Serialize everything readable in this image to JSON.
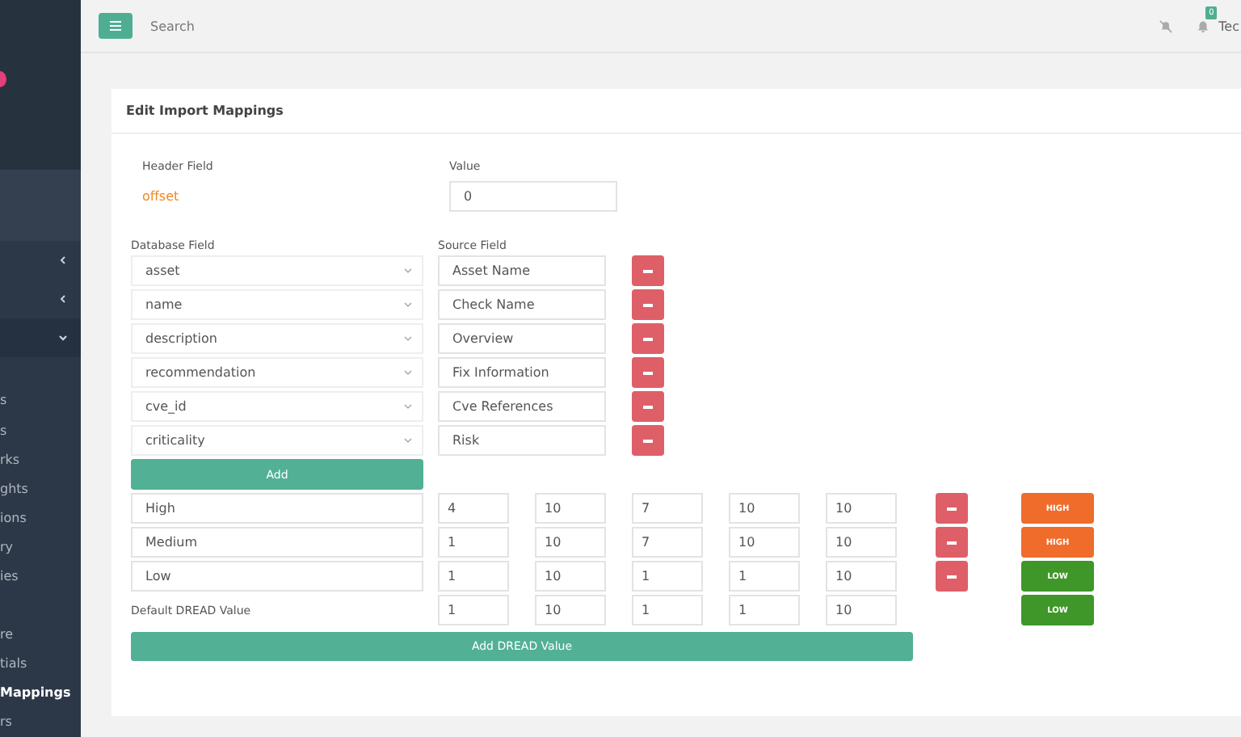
{
  "topbar": {
    "search_placeholder": "Search",
    "notification_count": "0",
    "user": "Tec"
  },
  "sidebar": {
    "items": [
      {
        "kind": "group",
        "expanded": false
      },
      {
        "kind": "group",
        "expanded": false
      },
      {
        "kind": "group",
        "expanded": true
      },
      {
        "kind": "link",
        "label": "s",
        "selected": false
      },
      {
        "kind": "link",
        "label": "s",
        "selected": false
      },
      {
        "kind": "link",
        "label": "rks",
        "selected": false
      },
      {
        "kind": "link",
        "label": "ghts",
        "selected": false
      },
      {
        "kind": "link",
        "label": "ions",
        "selected": false
      },
      {
        "kind": "link",
        "label": "ry",
        "selected": false
      },
      {
        "kind": "link",
        "label": "ies",
        "selected": false
      },
      {
        "kind": "link",
        "label": "re",
        "selected": false
      },
      {
        "kind": "link",
        "label": "tials",
        "selected": false
      },
      {
        "kind": "link",
        "label": "Mappings",
        "selected": true
      },
      {
        "kind": "link",
        "label": "rs",
        "selected": false
      }
    ]
  },
  "card": {
    "title": "Edit Import Mappings",
    "header": {
      "field_label": "Header Field",
      "value_label": "Value",
      "field": "offset",
      "value": "0"
    },
    "mappings": {
      "database_label": "Database Field",
      "source_label": "Source Field",
      "add_button": "Add",
      "rows": [
        {
          "database": "asset",
          "source": "Asset Name"
        },
        {
          "database": "name",
          "source": "Check Name"
        },
        {
          "database": "description",
          "source": "Overview"
        },
        {
          "database": "recommendation",
          "source": "Fix Information"
        },
        {
          "database": "cve_id",
          "source": "Cve References"
        },
        {
          "database": "criticality",
          "source": "Risk"
        }
      ]
    },
    "dread": {
      "rows": [
        {
          "kind": "entry",
          "name": "High",
          "values": [
            "4",
            "10",
            "7",
            "10",
            "10"
          ],
          "rating": {
            "text": "HIGH",
            "color": "#ef6c2b"
          }
        },
        {
          "kind": "entry",
          "name": "Medium",
          "values": [
            "1",
            "10",
            "7",
            "10",
            "10"
          ],
          "rating": {
            "text": "HIGH",
            "color": "#ef6c2b"
          }
        },
        {
          "kind": "entry",
          "name": "Low",
          "values": [
            "1",
            "10",
            "1",
            "1",
            "10"
          ],
          "rating": {
            "text": "LOW",
            "color": "#3f9629"
          }
        },
        {
          "kind": "default",
          "name": "Default DREAD Value",
          "values": [
            "1",
            "10",
            "1",
            "1",
            "10"
          ],
          "rating": {
            "text": "LOW",
            "color": "#3f9629"
          }
        }
      ],
      "add_button": "Add DREAD Value"
    }
  }
}
